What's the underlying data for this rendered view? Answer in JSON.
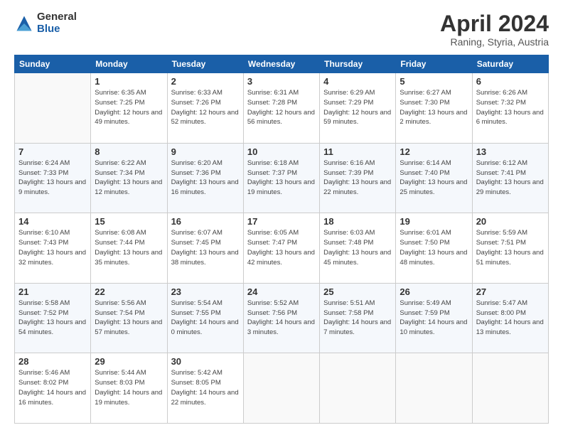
{
  "header": {
    "logo_general": "General",
    "logo_blue": "Blue",
    "month_title": "April 2024",
    "location": "Raning, Styria, Austria"
  },
  "weekdays": [
    "Sunday",
    "Monday",
    "Tuesday",
    "Wednesday",
    "Thursday",
    "Friday",
    "Saturday"
  ],
  "weeks": [
    [
      {
        "day": "",
        "info": ""
      },
      {
        "day": "1",
        "info": "Sunrise: 6:35 AM\nSunset: 7:25 PM\nDaylight: 12 hours\nand 49 minutes."
      },
      {
        "day": "2",
        "info": "Sunrise: 6:33 AM\nSunset: 7:26 PM\nDaylight: 12 hours\nand 52 minutes."
      },
      {
        "day": "3",
        "info": "Sunrise: 6:31 AM\nSunset: 7:28 PM\nDaylight: 12 hours\nand 56 minutes."
      },
      {
        "day": "4",
        "info": "Sunrise: 6:29 AM\nSunset: 7:29 PM\nDaylight: 12 hours\nand 59 minutes."
      },
      {
        "day": "5",
        "info": "Sunrise: 6:27 AM\nSunset: 7:30 PM\nDaylight: 13 hours\nand 2 minutes."
      },
      {
        "day": "6",
        "info": "Sunrise: 6:26 AM\nSunset: 7:32 PM\nDaylight: 13 hours\nand 6 minutes."
      }
    ],
    [
      {
        "day": "7",
        "info": "Sunrise: 6:24 AM\nSunset: 7:33 PM\nDaylight: 13 hours\nand 9 minutes."
      },
      {
        "day": "8",
        "info": "Sunrise: 6:22 AM\nSunset: 7:34 PM\nDaylight: 13 hours\nand 12 minutes."
      },
      {
        "day": "9",
        "info": "Sunrise: 6:20 AM\nSunset: 7:36 PM\nDaylight: 13 hours\nand 16 minutes."
      },
      {
        "day": "10",
        "info": "Sunrise: 6:18 AM\nSunset: 7:37 PM\nDaylight: 13 hours\nand 19 minutes."
      },
      {
        "day": "11",
        "info": "Sunrise: 6:16 AM\nSunset: 7:39 PM\nDaylight: 13 hours\nand 22 minutes."
      },
      {
        "day": "12",
        "info": "Sunrise: 6:14 AM\nSunset: 7:40 PM\nDaylight: 13 hours\nand 25 minutes."
      },
      {
        "day": "13",
        "info": "Sunrise: 6:12 AM\nSunset: 7:41 PM\nDaylight: 13 hours\nand 29 minutes."
      }
    ],
    [
      {
        "day": "14",
        "info": "Sunrise: 6:10 AM\nSunset: 7:43 PM\nDaylight: 13 hours\nand 32 minutes."
      },
      {
        "day": "15",
        "info": "Sunrise: 6:08 AM\nSunset: 7:44 PM\nDaylight: 13 hours\nand 35 minutes."
      },
      {
        "day": "16",
        "info": "Sunrise: 6:07 AM\nSunset: 7:45 PM\nDaylight: 13 hours\nand 38 minutes."
      },
      {
        "day": "17",
        "info": "Sunrise: 6:05 AM\nSunset: 7:47 PM\nDaylight: 13 hours\nand 42 minutes."
      },
      {
        "day": "18",
        "info": "Sunrise: 6:03 AM\nSunset: 7:48 PM\nDaylight: 13 hours\nand 45 minutes."
      },
      {
        "day": "19",
        "info": "Sunrise: 6:01 AM\nSunset: 7:50 PM\nDaylight: 13 hours\nand 48 minutes."
      },
      {
        "day": "20",
        "info": "Sunrise: 5:59 AM\nSunset: 7:51 PM\nDaylight: 13 hours\nand 51 minutes."
      }
    ],
    [
      {
        "day": "21",
        "info": "Sunrise: 5:58 AM\nSunset: 7:52 PM\nDaylight: 13 hours\nand 54 minutes."
      },
      {
        "day": "22",
        "info": "Sunrise: 5:56 AM\nSunset: 7:54 PM\nDaylight: 13 hours\nand 57 minutes."
      },
      {
        "day": "23",
        "info": "Sunrise: 5:54 AM\nSunset: 7:55 PM\nDaylight: 14 hours\nand 0 minutes."
      },
      {
        "day": "24",
        "info": "Sunrise: 5:52 AM\nSunset: 7:56 PM\nDaylight: 14 hours\nand 3 minutes."
      },
      {
        "day": "25",
        "info": "Sunrise: 5:51 AM\nSunset: 7:58 PM\nDaylight: 14 hours\nand 7 minutes."
      },
      {
        "day": "26",
        "info": "Sunrise: 5:49 AM\nSunset: 7:59 PM\nDaylight: 14 hours\nand 10 minutes."
      },
      {
        "day": "27",
        "info": "Sunrise: 5:47 AM\nSunset: 8:00 PM\nDaylight: 14 hours\nand 13 minutes."
      }
    ],
    [
      {
        "day": "28",
        "info": "Sunrise: 5:46 AM\nSunset: 8:02 PM\nDaylight: 14 hours\nand 16 minutes."
      },
      {
        "day": "29",
        "info": "Sunrise: 5:44 AM\nSunset: 8:03 PM\nDaylight: 14 hours\nand 19 minutes."
      },
      {
        "day": "30",
        "info": "Sunrise: 5:42 AM\nSunset: 8:05 PM\nDaylight: 14 hours\nand 22 minutes."
      },
      {
        "day": "",
        "info": ""
      },
      {
        "day": "",
        "info": ""
      },
      {
        "day": "",
        "info": ""
      },
      {
        "day": "",
        "info": ""
      }
    ]
  ]
}
